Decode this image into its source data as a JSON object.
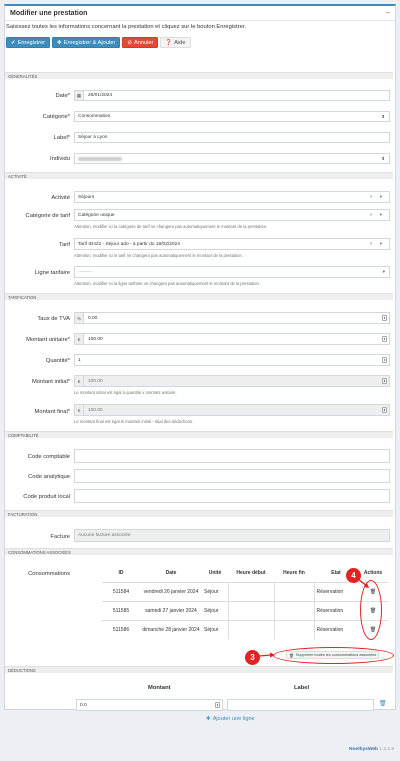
{
  "panel": {
    "title": "Modifier une prestation",
    "collapse_icon": "minus"
  },
  "intro": "Saisissez toutes les informations concernant la prestation et cliquez sur le bouton Enregistrer.",
  "toolbar": {
    "save": "Enregistrer",
    "save_add": "Enregistrer & Ajouter",
    "cancel": "Annuler",
    "help": "Aide"
  },
  "sections": {
    "generalites": "GÉNÉRALITÉS",
    "activite": "ACTIVITÉ",
    "tarification": "TARIFICATION",
    "comptabilite": "COMPTABILITÉ",
    "facturation": "FACTURATION",
    "consommations": "CONSOMMATIONS ASSOCIÉES",
    "deductions": "DÉDUCTIONS"
  },
  "fields": {
    "date": {
      "label": "Date*",
      "value": "26/01/2024"
    },
    "categorie": {
      "label": "Catégorie*",
      "value": "Consommation"
    },
    "label": {
      "label": "Label*",
      "value": "Séjour à Lyon"
    },
    "individu": {
      "label": "Individu",
      "value": ""
    },
    "activite": {
      "label": "Activité",
      "value": "Séjours"
    },
    "categorie_tarif": {
      "label": "Catégorie de tarif",
      "value": "Catégorie unique",
      "help": "Attention, modifier ici la catégorie de tarif ne changera pas automatiquement le montant de la prestation."
    },
    "tarif": {
      "label": "Tarif",
      "value": "Tarif ID422 - Séjour ado - à partir du 18/02/2024",
      "help": "Attention, modifier ici le tarif ne changera pas automatiquement le montant de la prestation."
    },
    "ligne_tarifaire": {
      "label": "Ligne tarifaire",
      "value": "---------",
      "help": "Attention, modifier ici la ligne tarifaire ne changera pas automatiquement le montant de la prestation."
    },
    "tva": {
      "label": "Taux de TVA",
      "addon": "%",
      "value": "0.00"
    },
    "montant_unitaire": {
      "label": "Montant unitaire*",
      "addon": "€",
      "value": "100.00"
    },
    "quantite": {
      "label": "Quantité*",
      "value": "1"
    },
    "montant_initial": {
      "label": "Montant initial*",
      "addon": "€",
      "value": "100.00",
      "help": "Le montant initial est égal à quantité x montant unitaire."
    },
    "montant_final": {
      "label": "Montant final*",
      "addon": "€",
      "value": "100.00",
      "help": "Le montant final est égal le montant initial - total des déductions."
    },
    "code_comptable": {
      "label": "Code comptable",
      "value": ""
    },
    "code_analytique": {
      "label": "Code analytique",
      "value": ""
    },
    "code_produit": {
      "label": "Code produit local",
      "value": ""
    },
    "facture": {
      "label": "Facture",
      "value": "Aucune facture associée"
    }
  },
  "consommations": {
    "label": "Consommations",
    "columns": [
      "ID",
      "Date",
      "Unité",
      "Heure début",
      "Heure fin",
      "Etat",
      "Actions"
    ],
    "rows": [
      {
        "id": "511584",
        "date": "vendredi 26 janvier 2024",
        "unite": "Séjour",
        "debut": "",
        "fin": "",
        "etat": "Réservation"
      },
      {
        "id": "511585",
        "date": "samedi 27 janvier 2024",
        "unite": "Séjour",
        "debut": "",
        "fin": "",
        "etat": "Réservation"
      },
      {
        "id": "511586",
        "date": "dimanche 28 janvier 2024",
        "unite": "Séjour",
        "debut": "",
        "fin": "",
        "etat": "Réservation"
      }
    ],
    "delete_all": "Supprimer toutes les consommations associées"
  },
  "deductions": {
    "col_montant": "Montant",
    "col_label": "Label",
    "row_montant": "0.0",
    "row_label": "",
    "add_line": "Ajouter une ligne"
  },
  "callouts": {
    "three": "3",
    "four": "4"
  },
  "footer": {
    "brand": "NoethysWeb",
    "version": "1.2.2.9"
  },
  "colors": {
    "primary": "#3c8dbc",
    "danger": "#dd4b39",
    "callout": "#e32222"
  }
}
